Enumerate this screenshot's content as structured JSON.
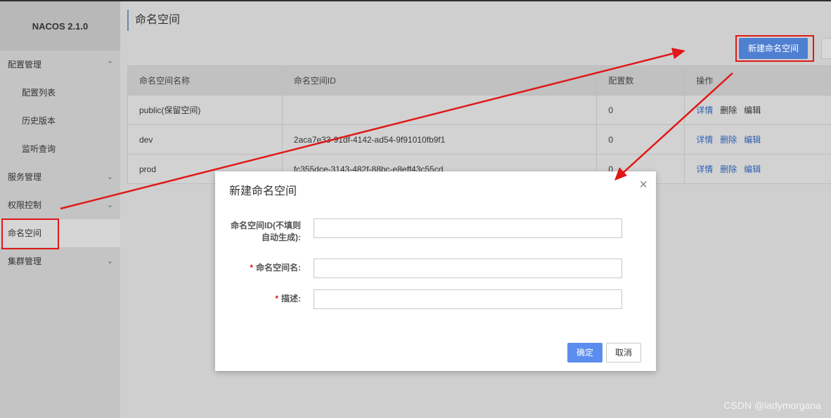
{
  "app": {
    "brand": "NACOS 2.1.0"
  },
  "sidebar": {
    "items": [
      {
        "label": "配置管理",
        "chevron": "⌃"
      },
      {
        "label": "配置列表"
      },
      {
        "label": "历史版本"
      },
      {
        "label": "监听查询"
      },
      {
        "label": "服务管理",
        "chevron": "⌄"
      },
      {
        "label": "权限控制",
        "chevron": "⌄"
      },
      {
        "label": "命名空间"
      },
      {
        "label": "集群管理",
        "chevron": "⌄"
      }
    ]
  },
  "main": {
    "title": "命名空间",
    "new_button": "新建命名空间",
    "table": {
      "headers": [
        "命名空间名称",
        "命名空间ID",
        "配置数",
        "操作"
      ],
      "rows": [
        {
          "name": "public(保留空间)",
          "id": "",
          "count": "0"
        },
        {
          "name": "dev",
          "id": "2aca7e33-91df-4142-ad54-9f91010fb9f1",
          "count": "0"
        },
        {
          "name": "prod",
          "id": "fc355dce-3143-482f-88bc-e8eff43c55cd",
          "count": "0"
        }
      ],
      "ops": {
        "detail": "详情",
        "delete": "删除",
        "edit": "编辑"
      }
    }
  },
  "dialog": {
    "title": "新建命名空间",
    "close_icon": "×",
    "fields": {
      "id_label_line1": "命名空间ID(不填则",
      "id_label_line2": "自动生成):",
      "name_label": "命名空间名:",
      "desc_label": "描述:",
      "required_mark": "*"
    },
    "ok": "确定",
    "cancel": "取消"
  },
  "colors": {
    "primary": "#4f7fd1",
    "annotation": "#e01818",
    "link": "#2d5fb0"
  },
  "watermark": "CSDN @ladymorgana"
}
